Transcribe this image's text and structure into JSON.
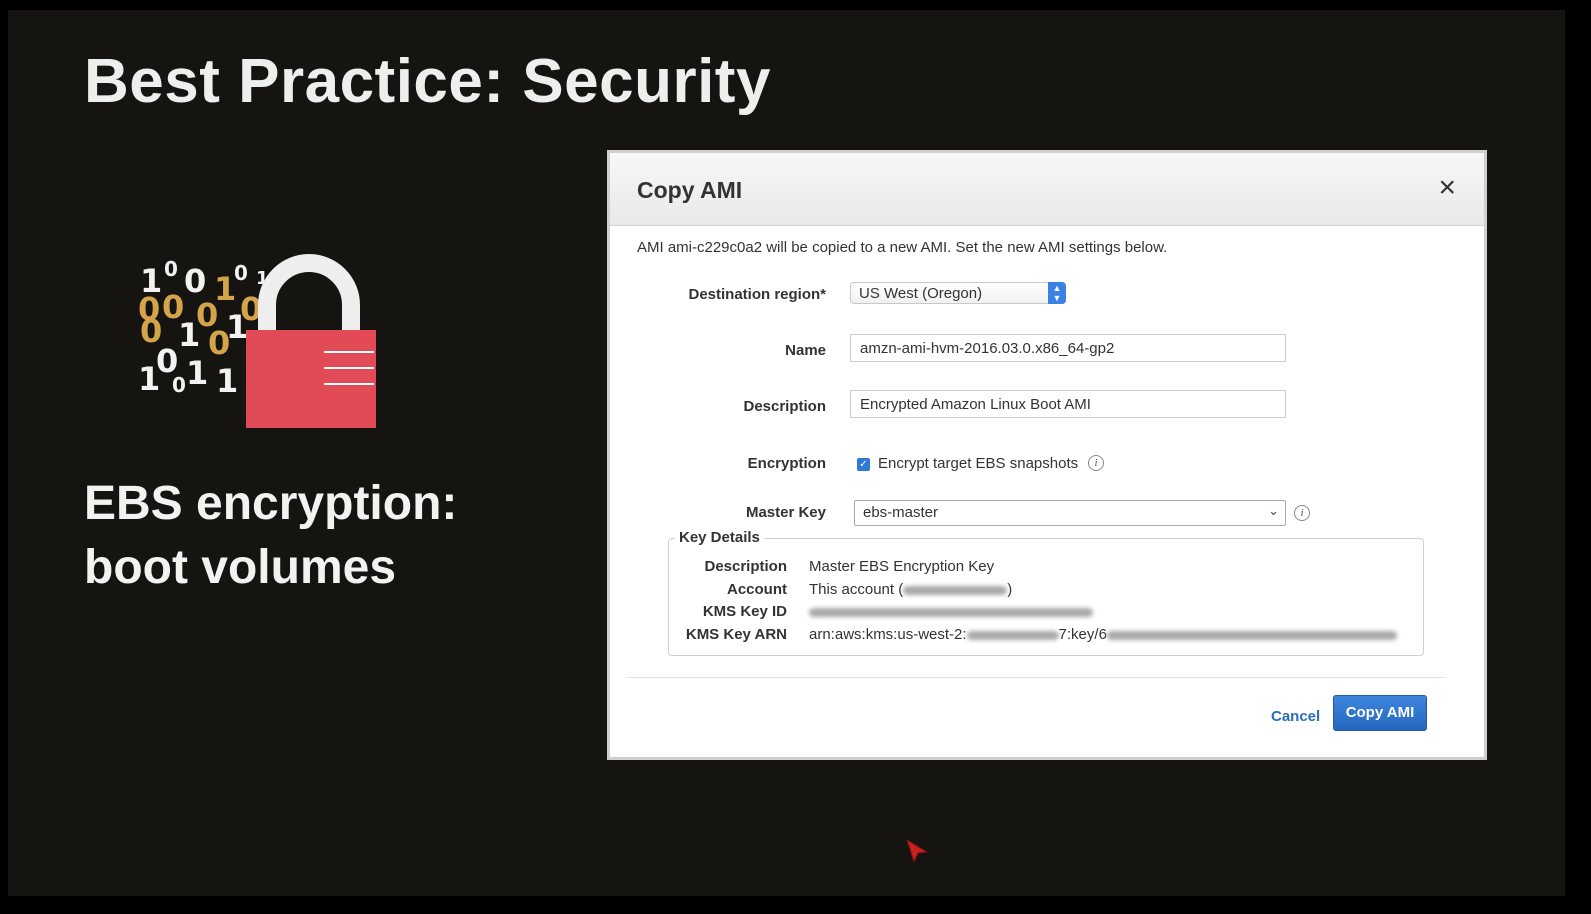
{
  "slide": {
    "title": "Best Practice: Security",
    "caption_line1": "EBS encryption:",
    "caption_line2": "boot volumes",
    "art_icon": "encrypted-lock-icon",
    "colors": {
      "lock_red": "#e24a57",
      "digit_gold": "#d4a44a",
      "digit_white": "#f2f2f2"
    }
  },
  "dialog": {
    "title": "Copy AMI",
    "close_glyph": "×",
    "intro": "AMI ami-c229c0a2 will be copied to a new AMI. Set the new AMI settings below.",
    "fields": {
      "region_label": "Destination region*",
      "region_value": "US West (Oregon)",
      "name_label": "Name",
      "name_value": "amzn-ami-hvm-2016.03.0.x86_64-gp2",
      "description_label": "Description",
      "description_value": "Encrypted Amazon Linux Boot AMI",
      "encryption_label": "Encryption",
      "encryption_checked": true,
      "encryption_text": "Encrypt target EBS snapshots",
      "master_key_label": "Master Key",
      "master_key_value": "ebs-master"
    },
    "key_details": {
      "legend": "Key Details",
      "description_label": "Description",
      "description_value": "Master EBS Encryption Key",
      "account_label": "Account",
      "account_prefix": "This account (",
      "account_suffix": ")",
      "kms_key_id_label": "KMS Key ID",
      "kms_key_arn_label": "KMS Key ARN",
      "kms_key_arn_prefix": "arn:aws:kms:us-west-2:",
      "kms_key_arn_mid": "7:key/6"
    },
    "buttons": {
      "cancel": "Cancel",
      "copy": "Copy AMI"
    },
    "colors": {
      "primary": "#2f78d6",
      "link": "#2a6ebd"
    }
  }
}
